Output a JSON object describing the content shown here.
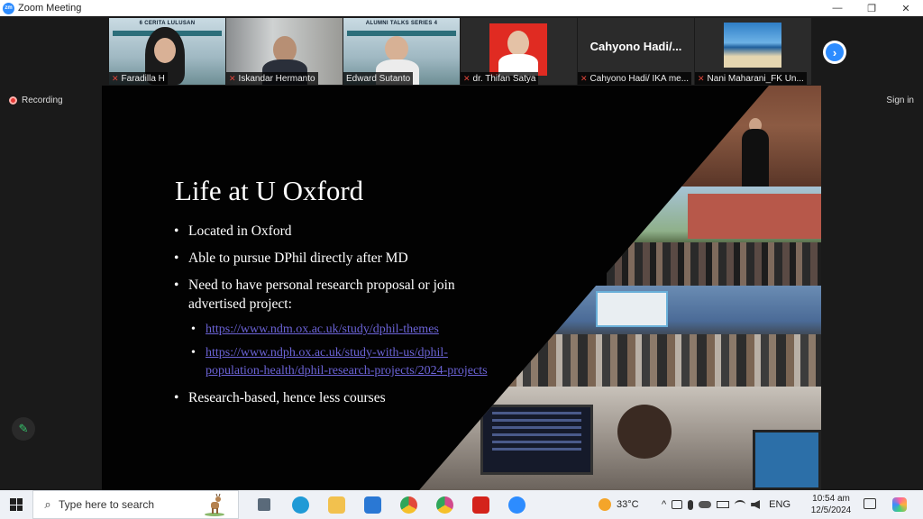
{
  "window": {
    "title": "Zoom Meeting",
    "app_logo_text": "zm",
    "controls": {
      "minimize": "—",
      "restore": "❐",
      "close": "✕"
    }
  },
  "participants": [
    {
      "name": "Faradilla H",
      "poster_title": "6 CERITA LULUSAN",
      "muted": true
    },
    {
      "name": "Iskandar Hermanto",
      "muted": true
    },
    {
      "name": "Edward Sutanto",
      "poster_title": "ALUMNI TALKS SERIES 4",
      "muted": true,
      "active_speaker": true
    },
    {
      "name": "dr. Thifan Satya",
      "muted": true
    },
    {
      "name": "Cahyono Hadi/ IKA me...",
      "tile_text": "Cahyono  Hadi/...",
      "muted": true
    },
    {
      "name": "Nani Maharani_FK Un...",
      "muted": true
    }
  ],
  "next_button_label": "›",
  "recording_label": "Recording",
  "sign_in_label": "Sign in",
  "annotate_icon": "✎",
  "slide": {
    "title": "Life at U Oxford",
    "bullets": [
      "Located in Oxford",
      "Able to pursue DPhil directly after MD",
      "Need to have personal research proposal or join advertised project:",
      "Research-based, hence less courses"
    ],
    "links": [
      "https://www.ndm.ox.ac.uk/study/dphil-themes",
      "https://www.ndph.ox.ac.uk/study-with-us/dphil-population-health/dphil-research-projects/2024-projects"
    ]
  },
  "taskbar": {
    "search_placeholder": "Type here to search",
    "search_icon": "⌕",
    "temperature": "33°C",
    "language": "ENG",
    "time": "10:54 am",
    "date": "12/5/2024",
    "tray_chevron": "^",
    "apps": [
      {
        "name": "task-view",
        "color": "#5a6a7a"
      },
      {
        "name": "edge",
        "color": "#1f9ad6"
      },
      {
        "name": "file-explorer",
        "color": "#f2c14e"
      },
      {
        "name": "mail",
        "color": "#2a78d4"
      },
      {
        "name": "chrome",
        "color": "#e2493a"
      },
      {
        "name": "chrome-profile",
        "color": "#d24a8c"
      },
      {
        "name": "acrobat",
        "color": "#d4231b"
      },
      {
        "name": "zoom",
        "color": "#2d8cff"
      }
    ]
  }
}
